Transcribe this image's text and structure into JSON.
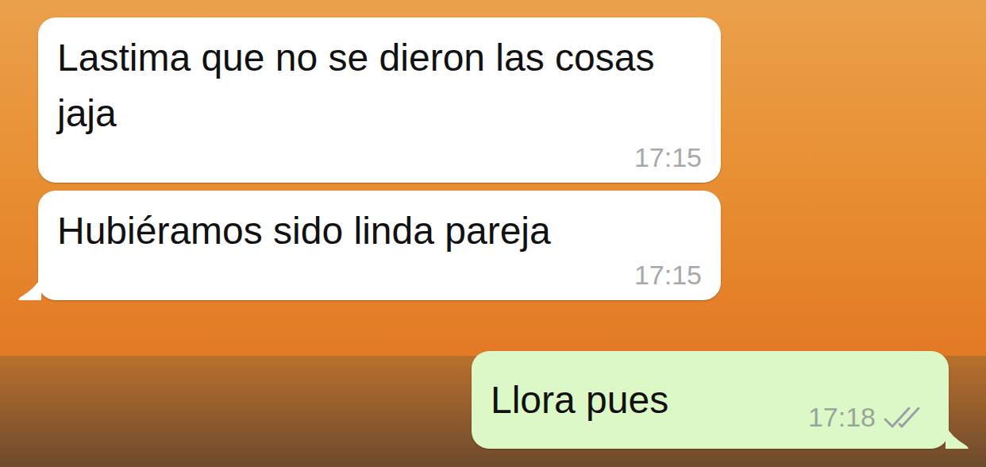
{
  "chat": {
    "messages": [
      {
        "kind": "incoming",
        "text": "Lastima que no se dieron las cosas jaja",
        "time": "17:15",
        "tail": false
      },
      {
        "kind": "incoming",
        "text": "Hubiéramos sido linda pareja",
        "time": "17:15",
        "tail": true
      },
      {
        "kind": "outgoing",
        "text": "Llora pues",
        "time": "17:18",
        "tail": true,
        "read": false
      }
    ]
  }
}
